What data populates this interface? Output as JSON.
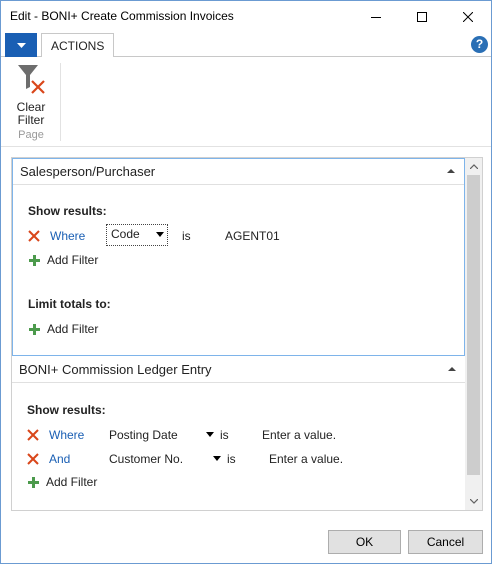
{
  "window": {
    "title": "Edit - BONI+ Create Commission Invoices"
  },
  "ribbon": {
    "tab_label": "ACTIONS",
    "clear_filter_line1": "Clear",
    "clear_filter_line2": "Filter",
    "group_label": "Page"
  },
  "sections": [
    {
      "title": "Salesperson/Purchaser",
      "show_results_label": "Show results:",
      "filters": [
        {
          "conjunction": "Where",
          "field": "Code",
          "operator": "is",
          "value": "AGENT01"
        }
      ],
      "add_filter_label": "Add Filter",
      "limit_totals_label": "Limit totals to:",
      "limit_add_filter_label": "Add Filter"
    },
    {
      "title": "BONI+ Commission Ledger Entry",
      "show_results_label": "Show results:",
      "filters": [
        {
          "conjunction": "Where",
          "field": "Posting Date",
          "operator": "is",
          "value": "Enter a value."
        },
        {
          "conjunction": "And",
          "field": "Customer No.",
          "operator": "is",
          "value": "Enter a value."
        }
      ],
      "add_filter_label": "Add Filter"
    }
  ],
  "footer": {
    "ok_label": "OK",
    "cancel_label": "Cancel"
  },
  "icons": {
    "app_menu": "dropdown-arrow-icon",
    "help": "help-icon",
    "clear_filter": "clear-filter-icon",
    "remove_filter": "remove-x-icon",
    "add_filter": "plus-icon",
    "collapse": "chevron-up-icon"
  },
  "colors": {
    "accent": "#1a5fb4",
    "remove_icon": "#d9461a",
    "add_icon": "#4c9a4c",
    "focus_border": "#7eb4ea"
  }
}
